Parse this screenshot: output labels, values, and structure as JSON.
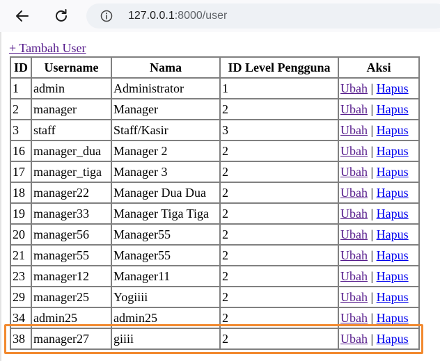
{
  "browser": {
    "url_host": "127.0.0.1",
    "url_rest": ":8000/user"
  },
  "page": {
    "add_link": "+ Tambah User"
  },
  "table": {
    "headers": [
      "ID",
      "Username",
      "Nama",
      "ID Level Pengguna",
      "Aksi"
    ],
    "edit_label": "Ubah",
    "delete_label": "Hapus",
    "separator": "|",
    "rows": [
      {
        "id": "1",
        "username": "admin",
        "nama": "Administrator",
        "level": "1"
      },
      {
        "id": "2",
        "username": "manager",
        "nama": "Manager",
        "level": "2"
      },
      {
        "id": "3",
        "username": "staff",
        "nama": "Staff/Kasir",
        "level": "3"
      },
      {
        "id": "16",
        "username": "manager_dua",
        "nama": "Manager 2",
        "level": "2"
      },
      {
        "id": "17",
        "username": "manager_tiga",
        "nama": "Manager 3",
        "level": "2"
      },
      {
        "id": "18",
        "username": "manager22",
        "nama": "Manager Dua Dua",
        "level": "2"
      },
      {
        "id": "19",
        "username": "manager33",
        "nama": "Manager Tiga Tiga",
        "level": "2"
      },
      {
        "id": "20",
        "username": "manager56",
        "nama": "Manager55",
        "level": "2"
      },
      {
        "id": "21",
        "username": "manager55",
        "nama": "Manager55",
        "level": "2"
      },
      {
        "id": "23",
        "username": "manager12",
        "nama": "Manager11",
        "level": "2"
      },
      {
        "id": "29",
        "username": "manager25",
        "nama": "Yogiiii",
        "level": "2"
      },
      {
        "id": "34",
        "username": "admin25",
        "nama": "admin25",
        "level": "2"
      },
      {
        "id": "38",
        "username": "manager27",
        "nama": "giiii",
        "level": "2"
      }
    ]
  },
  "colors": {
    "highlight": "#f28a30",
    "visited_link": "#551a8b",
    "link": "#0000ee"
  },
  "icons": [
    "back-arrow-icon",
    "reload-icon",
    "site-info-icon"
  ]
}
